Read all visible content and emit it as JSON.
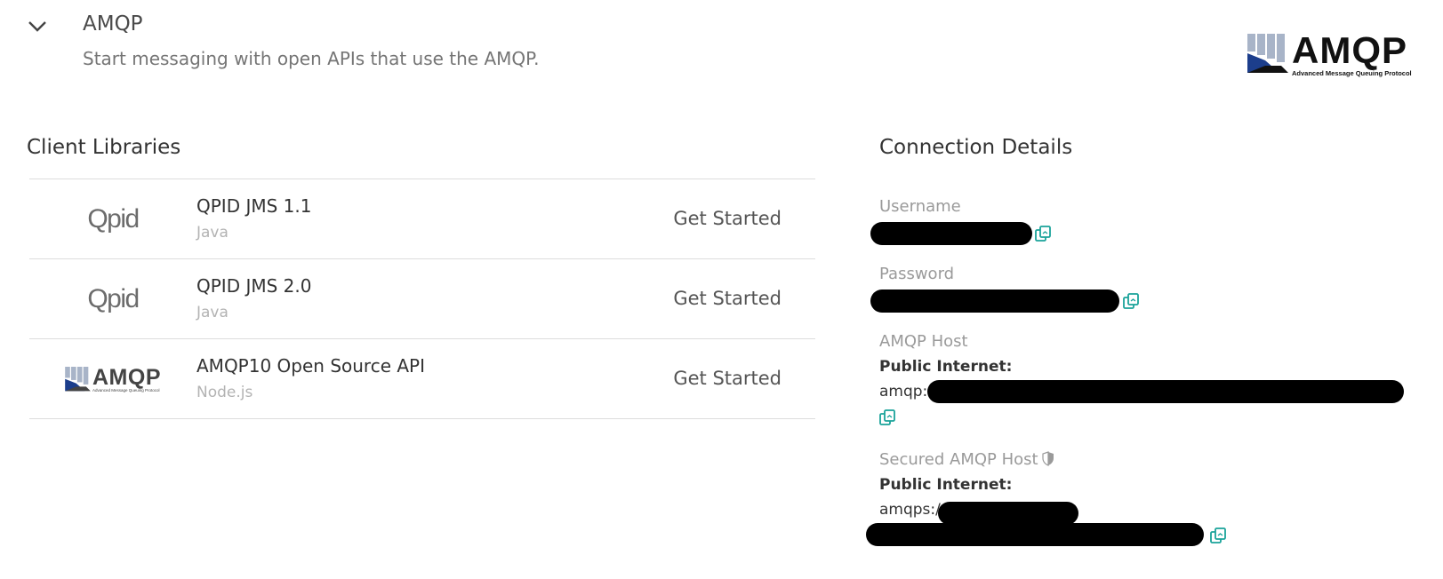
{
  "header": {
    "title": "AMQP",
    "subtitle": "Start messaging with open APIs that use the AMQP.",
    "logo": {
      "word": "AMQP",
      "tagline": "Advanced Message Queuing Protocol"
    }
  },
  "client_libraries": {
    "heading": "Client Libraries",
    "items": [
      {
        "logo_text": "Qpid",
        "name": "QPID JMS 1.1",
        "language": "Java",
        "action": "Get Started"
      },
      {
        "logo_text": "Qpid",
        "name": "QPID JMS 2.0",
        "language": "Java",
        "action": "Get Started"
      },
      {
        "logo_text": "AMQP",
        "logo_tagline": "Advanced Message Queuing Protocol",
        "name": "AMQP10 Open Source API",
        "language": "Node.js",
        "action": "Get Started"
      }
    ]
  },
  "connection_details": {
    "heading": "Connection Details",
    "username_label": "Username",
    "password_label": "Password",
    "amqp_host": {
      "label": "AMQP Host",
      "network_label": "Public Internet:",
      "value_prefix": "amqp:"
    },
    "secured_amqp_host": {
      "label": "Secured AMQP Host",
      "network_label": "Public Internet:",
      "value_prefix": "amqps:/"
    }
  },
  "icons": {
    "collapse": "chevron-down-icon",
    "copy": "copy-icon",
    "secure": "shield-icon"
  },
  "colors": {
    "copy_icon": "#1aa39a",
    "logo_blue": "#1c3e8c",
    "logo_gray": "#a8b4c8",
    "redaction": "#000000"
  }
}
